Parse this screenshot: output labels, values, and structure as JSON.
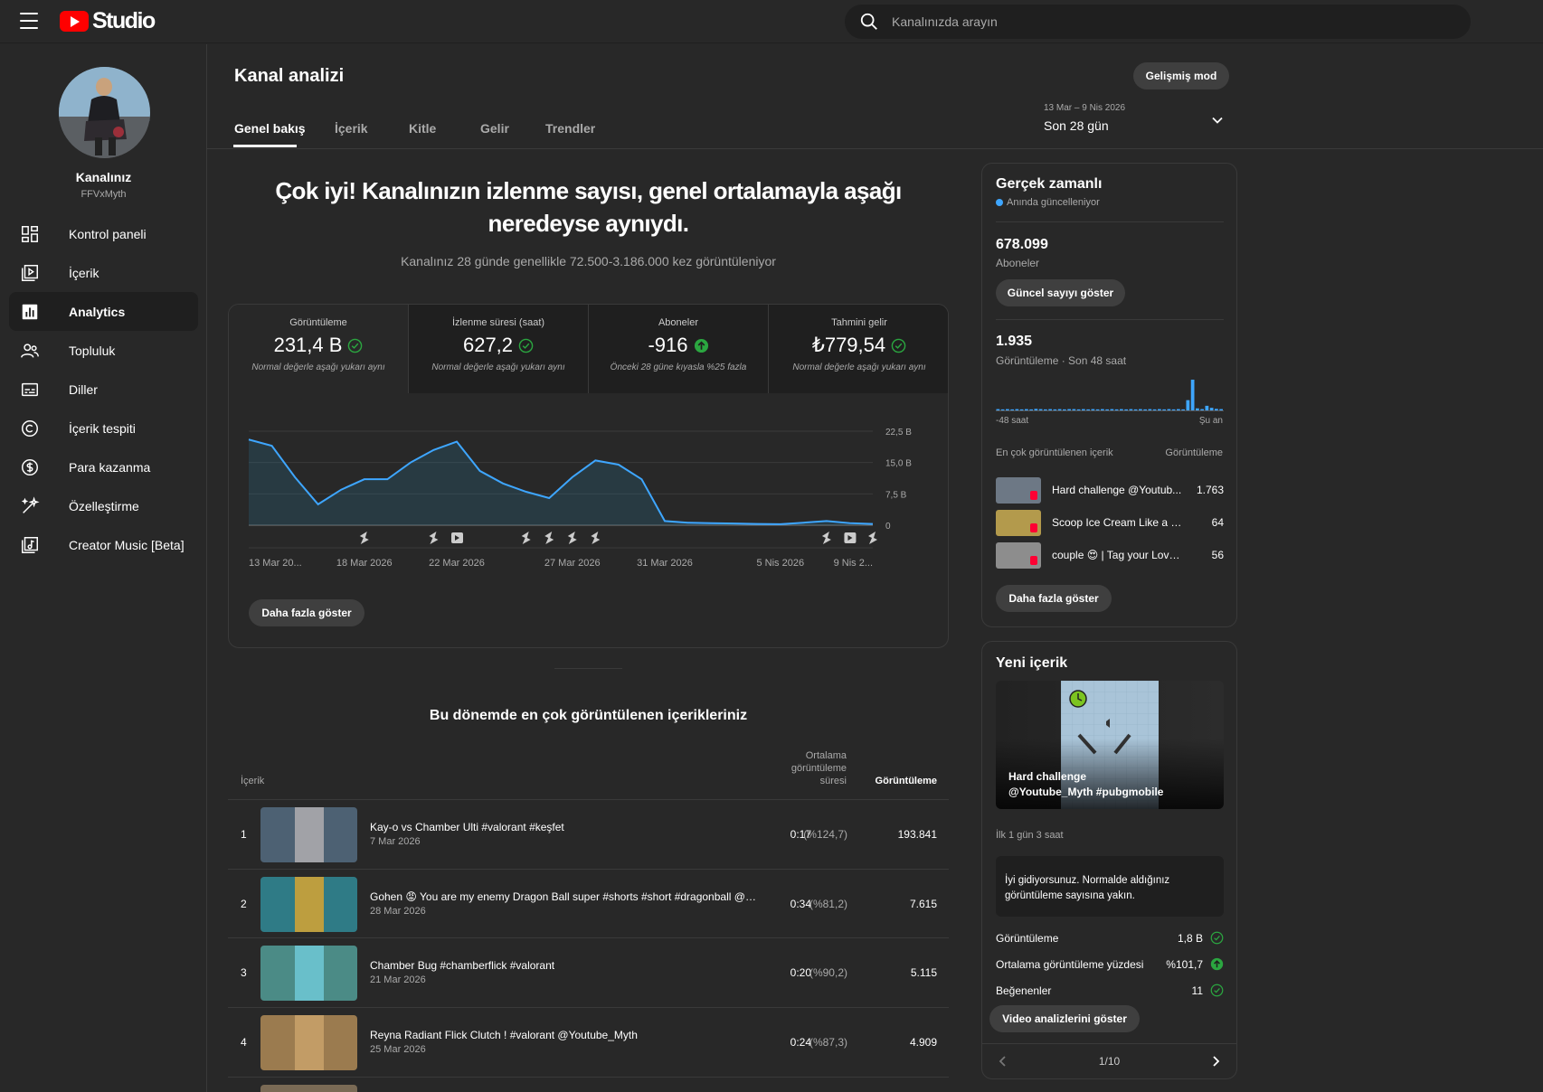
{
  "app": {
    "logo_text": "Studio"
  },
  "search": {
    "placeholder": "Kanalınızda arayın"
  },
  "channel": {
    "name": "Kanalınız",
    "handle": "FFVxMyth"
  },
  "sidebar": {
    "items": [
      {
        "label": "Kontrol paneli",
        "icon": "dashboard-icon"
      },
      {
        "label": "İçerik",
        "icon": "content-icon"
      },
      {
        "label": "Analytics",
        "icon": "analytics-icon",
        "active": true
      },
      {
        "label": "Topluluk",
        "icon": "community-icon"
      },
      {
        "label": "Diller",
        "icon": "subtitles-icon"
      },
      {
        "label": "İçerik tespiti",
        "icon": "copyright-icon"
      },
      {
        "label": "Para kazanma",
        "icon": "monetization-icon"
      },
      {
        "label": "Özelleştirme",
        "icon": "customization-icon"
      },
      {
        "label": "Creator Music [Beta]",
        "icon": "music-icon"
      }
    ]
  },
  "header": {
    "title": "Kanal analizi",
    "advanced_mode": "Gelişmiş mod",
    "tabs": [
      "Genel bakış",
      "İçerik",
      "Kitle",
      "Gelir",
      "Trendler"
    ],
    "date_range": "13 Mar – 9 Nis 2026",
    "date_preset": "Son 28 gün"
  },
  "summary": {
    "headline_line1": "Çok iyi! Kanalınızın izlenme sayısı, genel ortalamayla aşağı",
    "headline_line2": "neredeyse aynıydı.",
    "subline": "Kanalınız 28 günde genellikle 72.500-3.186.000 kez görüntüleniyor"
  },
  "metrics": [
    {
      "label": "Görüntüleme",
      "value": "231,4 B",
      "note": "Normal değerle aşağı yukarı aynı",
      "status": "check"
    },
    {
      "label": "İzlenme süresi (saat)",
      "value": "627,2",
      "note": "Normal değerle aşağı yukarı aynı",
      "status": "check"
    },
    {
      "label": "Aboneler",
      "value": "-916",
      "note": "Önceki 28 güne kıyasla %25 fazla",
      "status": "up"
    },
    {
      "label": "Tahmini gelir",
      "value": "₺779,54",
      "note": "Normal değerle aşağı yukarı aynı",
      "status": "check"
    }
  ],
  "chart_data": {
    "type": "area",
    "x_tick_labels": [
      "13 Mar 20...",
      "18 Mar 2026",
      "22 Mar 2026",
      "27 Mar 2026",
      "31 Mar 2026",
      "5 Nis 2026",
      "9 Nis 2..."
    ],
    "y_tick_labels": [
      "22,5 B",
      "15,0 B",
      "7,5 B",
      "0"
    ],
    "ylim": [
      0,
      22500
    ],
    "x": [
      "13 Mar",
      "14 Mar",
      "15 Mar",
      "16 Mar",
      "17 Mar",
      "18 Mar",
      "19 Mar",
      "20 Mar",
      "21 Mar",
      "22 Mar",
      "23 Mar",
      "24 Mar",
      "25 Mar",
      "26 Mar",
      "27 Mar",
      "28 Mar",
      "29 Mar",
      "30 Mar",
      "31 Mar",
      "1 Nis",
      "2 Nis",
      "3 Nis",
      "4 Nis",
      "5 Nis",
      "6 Nis",
      "7 Nis",
      "8 Nis",
      "9 Nis"
    ],
    "series": [
      {
        "values": [
          20500,
          19000,
          11500,
          5000,
          8500,
          11000,
          11000,
          15000,
          18000,
          20000,
          13000,
          10000,
          8000,
          6500,
          11500,
          15500,
          14500,
          11000,
          1000,
          600,
          500,
          400,
          300,
          250,
          600,
          1000,
          500,
          300
        ]
      }
    ],
    "upload_markers": [
      {
        "x": "18 Mar",
        "kind": "short"
      },
      {
        "x": "21 Mar",
        "kind": "short"
      },
      {
        "x": "22 Mar",
        "kind": "video"
      },
      {
        "x": "25 Mar",
        "kind": "short"
      },
      {
        "x": "26 Mar",
        "kind": "short"
      },
      {
        "x": "27 Mar",
        "kind": "short"
      },
      {
        "x": "28 Mar",
        "kind": "short"
      },
      {
        "x": "7 Nis",
        "kind": "short"
      },
      {
        "x": "8 Nis",
        "kind": "video"
      },
      {
        "x": "9 Nis",
        "kind": "short"
      }
    ],
    "show_more": "Daha fazla göster"
  },
  "top_content": {
    "title": "Bu dönemde en çok görüntülenen içerikleriniz",
    "col_content": "İçerik",
    "col_avg_line1": "Ortalama",
    "col_avg_line2": "görüntüleme",
    "col_avg_line3": "süresi",
    "col_views": "Görüntüleme",
    "rows": [
      {
        "rank": "1",
        "title": "Kay-o vs Chamber Ulti #valorant #keşfet",
        "date": "7 Mar 2026",
        "avg": "0:17",
        "pct": "(%124,7)",
        "views": "193.841",
        "thumb": "#4d6173",
        "thumb2": "#b0aeb0"
      },
      {
        "rank": "2",
        "title": "Gohen 😡 You are my enemy Dragon Ball super #shorts #short #dragonball @Yo...",
        "date": "28 Mar 2026",
        "avg": "0:34",
        "pct": "(%81,2)",
        "views": "7.615",
        "thumb": "#2f7b86",
        "thumb2": "#d6a432"
      },
      {
        "rank": "3",
        "title": "Chamber Bug #chamberflick #valorant",
        "date": "21 Mar 2026",
        "avg": "0:20",
        "pct": "(%90,2)",
        "views": "5.115",
        "thumb": "#4b8b86",
        "thumb2": "#6fc8d6"
      },
      {
        "rank": "4",
        "title": "Reyna Radiant Flick Clutch ! #valorant @Youtube_Myth",
        "date": "25 Mar 2026",
        "avg": "0:24",
        "pct": "(%87,3)",
        "views": "4.909",
        "thumb": "#9b7b4f",
        "thumb2": "#c9a26a"
      }
    ]
  },
  "realtime": {
    "title": "Gerçek zamanlı",
    "live_label": "Anında güncelleniyor",
    "subscribers": "678.099",
    "subscribers_label": "Aboneler",
    "show_count": "Güncel sayıyı göster",
    "views": "1.935",
    "views_label": "Görüntüleme · Son 48 saat",
    "axis_start": "-48 saat",
    "axis_end": "Şu an",
    "hourly_views": [
      5,
      4,
      5,
      4,
      5,
      4,
      5,
      4,
      6,
      5,
      4,
      5,
      4,
      5,
      4,
      5,
      5,
      4,
      5,
      4,
      5,
      4,
      5,
      4,
      5,
      4,
      5,
      4,
      5,
      4,
      5,
      4,
      5,
      4,
      5,
      4,
      5,
      4,
      5,
      4,
      40,
      120,
      8,
      5,
      18,
      10,
      6,
      5
    ],
    "top_label": "En çok görüntülenen içerik",
    "top_col": "Görüntüleme",
    "top_items": [
      {
        "title": "Hard challenge @Youtub...",
        "views": "1.763",
        "thumb": "#6d7885"
      },
      {
        "title": "Scoop Ice Cream Like a Che...",
        "views": "64",
        "thumb": "#b39a4c"
      },
      {
        "title": "couple 😍 | Tag your Love ...",
        "views": "56",
        "thumb": "#8d8d8d"
      }
    ],
    "show_more": "Daha fazla göster"
  },
  "new_content": {
    "title": "Yeni içerik",
    "video_title": "Hard challenge @Youtube_Myth #pubgmobile",
    "age": "İlk 1 gün 3 saat",
    "message": "İyi gidiyorsunuz. Normalde aldığınız görüntüleme sayısına yakın.",
    "stats": [
      {
        "label": "Görüntüleme",
        "value": "1,8 B",
        "status": "check"
      },
      {
        "label": "Ortalama görüntüleme yüzdesi",
        "value": "%101,7",
        "status": "up"
      },
      {
        "label": "Beğenenler",
        "value": "11",
        "status": "check"
      }
    ],
    "analytics_button": "Video analizlerini göster",
    "pager": "1/10"
  },
  "colors": {
    "accent_blue": "#3ea6ff",
    "success_green": "#2ba640",
    "brand_red": "#ff0000"
  }
}
